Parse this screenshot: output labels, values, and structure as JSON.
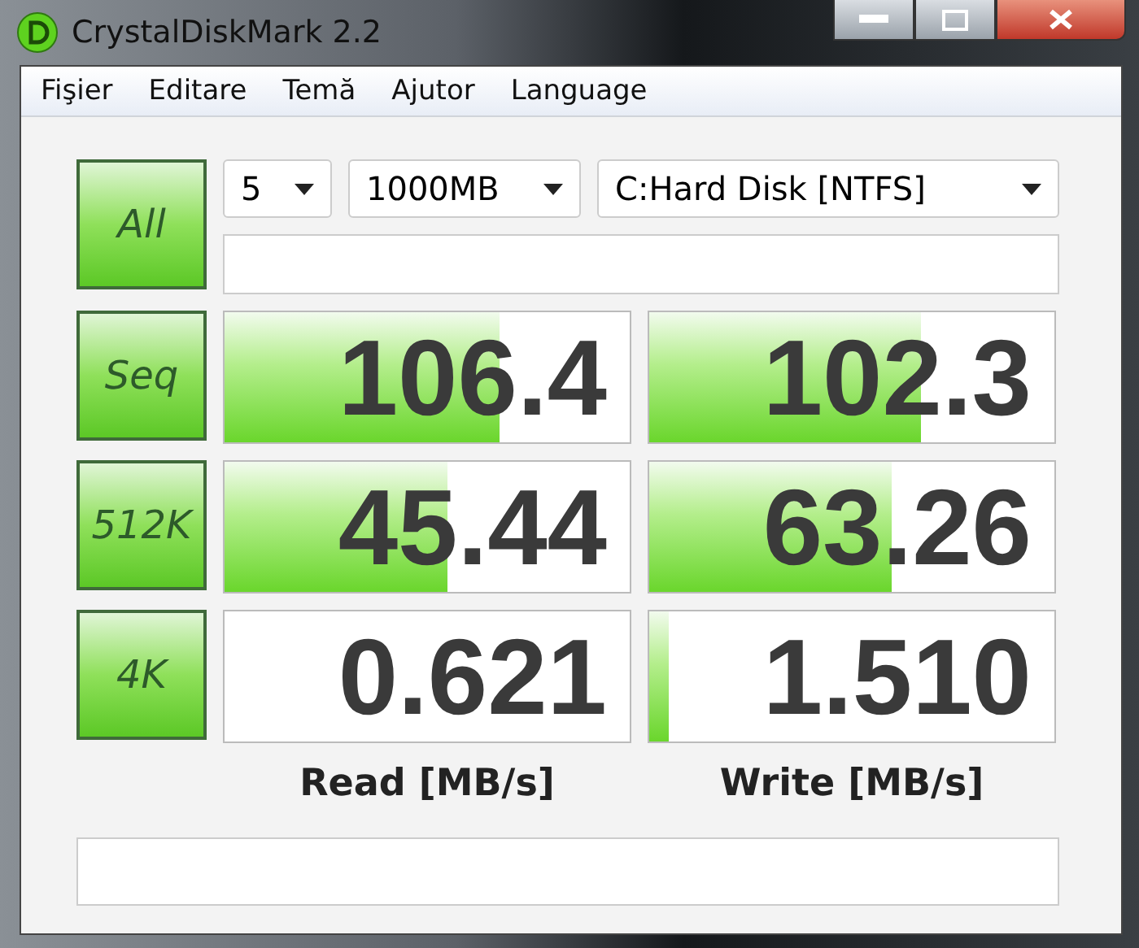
{
  "window": {
    "title": "CrystalDiskMark 2.2"
  },
  "menu": [
    "Fişier",
    "Editare",
    "Temă",
    "Ajutor",
    "Language"
  ],
  "all_button": "All",
  "controls": {
    "count": "5",
    "size": "1000MB",
    "drive": "C:Hard Disk [NTFS]"
  },
  "rows": [
    {
      "label": "Seq",
      "read": {
        "value": "106.4",
        "level": 0.68
      },
      "write": {
        "value": "102.3",
        "level": 0.67
      }
    },
    {
      "label": "512K",
      "read": {
        "value": "45.44",
        "level": 0.55
      },
      "write": {
        "value": "63.26",
        "level": 0.6
      }
    },
    {
      "label": "4K",
      "read": {
        "value": "0.621",
        "level": 0.0
      },
      "write": {
        "value": "1.510",
        "level": 0.05
      }
    }
  ],
  "headings": [
    "Read [MB/s]",
    "Write [MB/s]"
  ]
}
